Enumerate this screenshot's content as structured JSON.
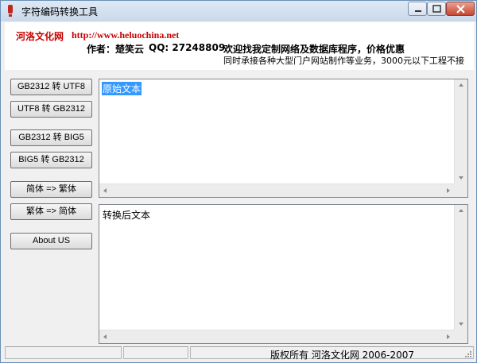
{
  "window": {
    "title": "字符编码转换工具"
  },
  "header": {
    "brand": "河洛文化网",
    "url": "http://www.heluochina.net",
    "author": "作者：楚笑云",
    "qq": "QQ: 27248809",
    "promo_line1": "欢迎找我定制网络及数据库程序，价格优惠",
    "promo_line2": "同时承接各种大型门户网站制作等业务，3000元以下工程不接"
  },
  "buttons": {
    "gb_to_utf8": "GB2312 转 UTF8",
    "utf8_to_gb": "UTF8 转 GB2312",
    "gb_to_big5": "GB2312 转 BIG5",
    "big5_to_gb": "BIG5 转 GB2312",
    "simp_to_trad": "简体 => 繁体",
    "trad_to_simp": "繁体 => 简体",
    "about": "About US"
  },
  "source_text": "原始文本",
  "result_text": "转换后文本",
  "statusbar": {
    "copyright": "版权所有  河洛文化网  2006-2007"
  }
}
